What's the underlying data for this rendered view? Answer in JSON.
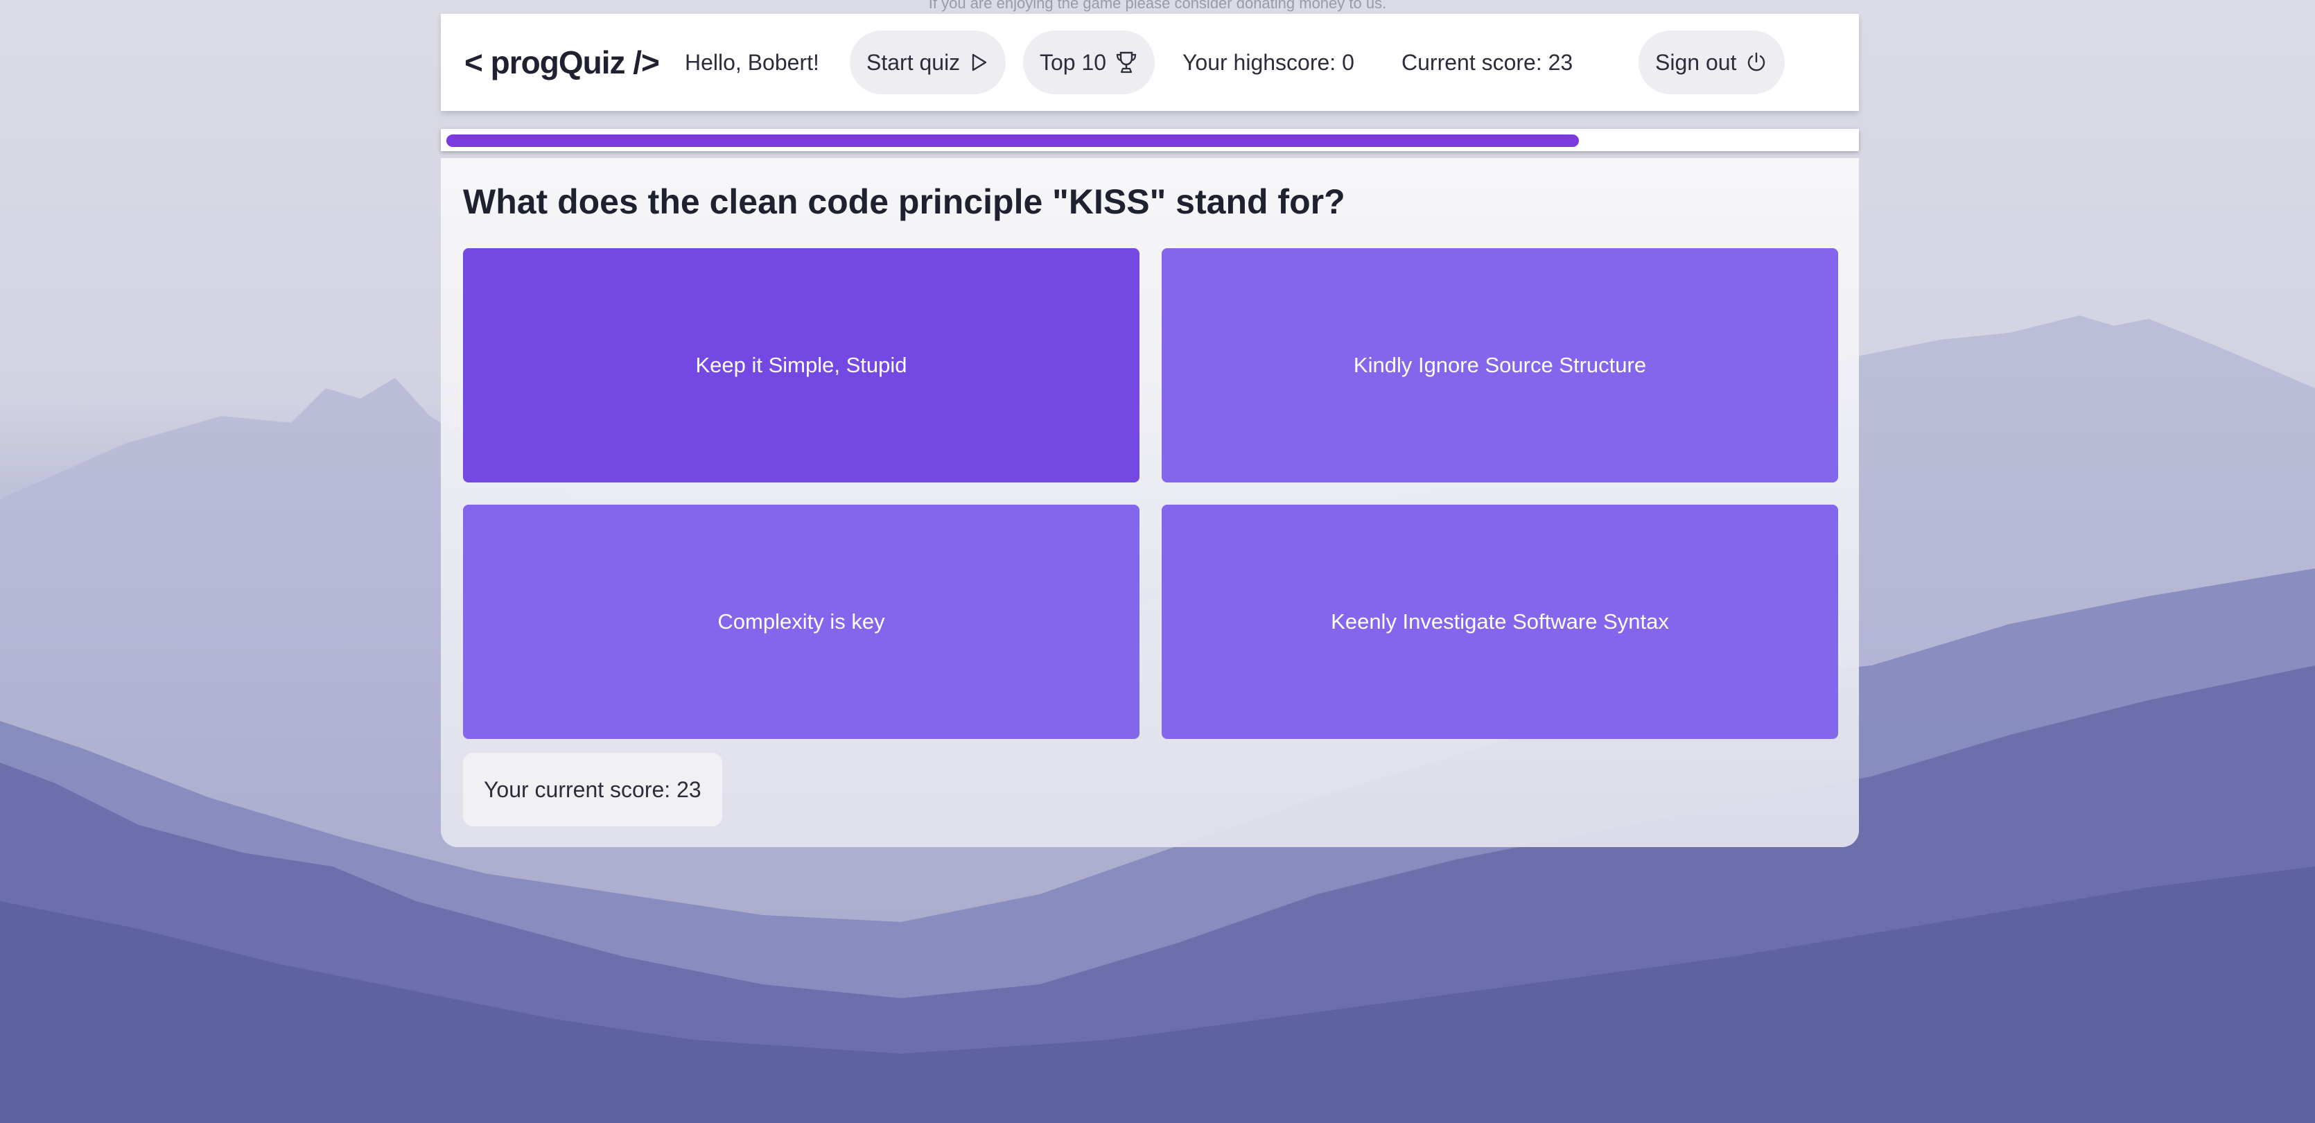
{
  "top_note": "If you are enjoying the game please consider donating money to us.",
  "header": {
    "logo": "< progQuiz />",
    "greeting": "Hello, Bobert!",
    "start_quiz_label": "Start quiz",
    "top10_label": "Top 10",
    "highscore_text": "Your highscore: 0",
    "current_score_text": "Current score: 23",
    "sign_out_label": "Sign out"
  },
  "progress": {
    "fraction": 0.805,
    "color": "#7a3adf"
  },
  "quiz": {
    "question": "What does the clean code principle \"KISS\" stand for?",
    "answers": [
      {
        "label": "Keep it Simple, Stupid",
        "selected": true
      },
      {
        "label": "Kindly Ignore Source Structure",
        "selected": false
      },
      {
        "label": "Complexity is key",
        "selected": false
      },
      {
        "label": "Keenly Investigate Software Syntax",
        "selected": false
      }
    ],
    "score_text": "Your current score: 23"
  },
  "colors": {
    "answer": "#8466ec",
    "answer_selected": "#7449e3"
  }
}
